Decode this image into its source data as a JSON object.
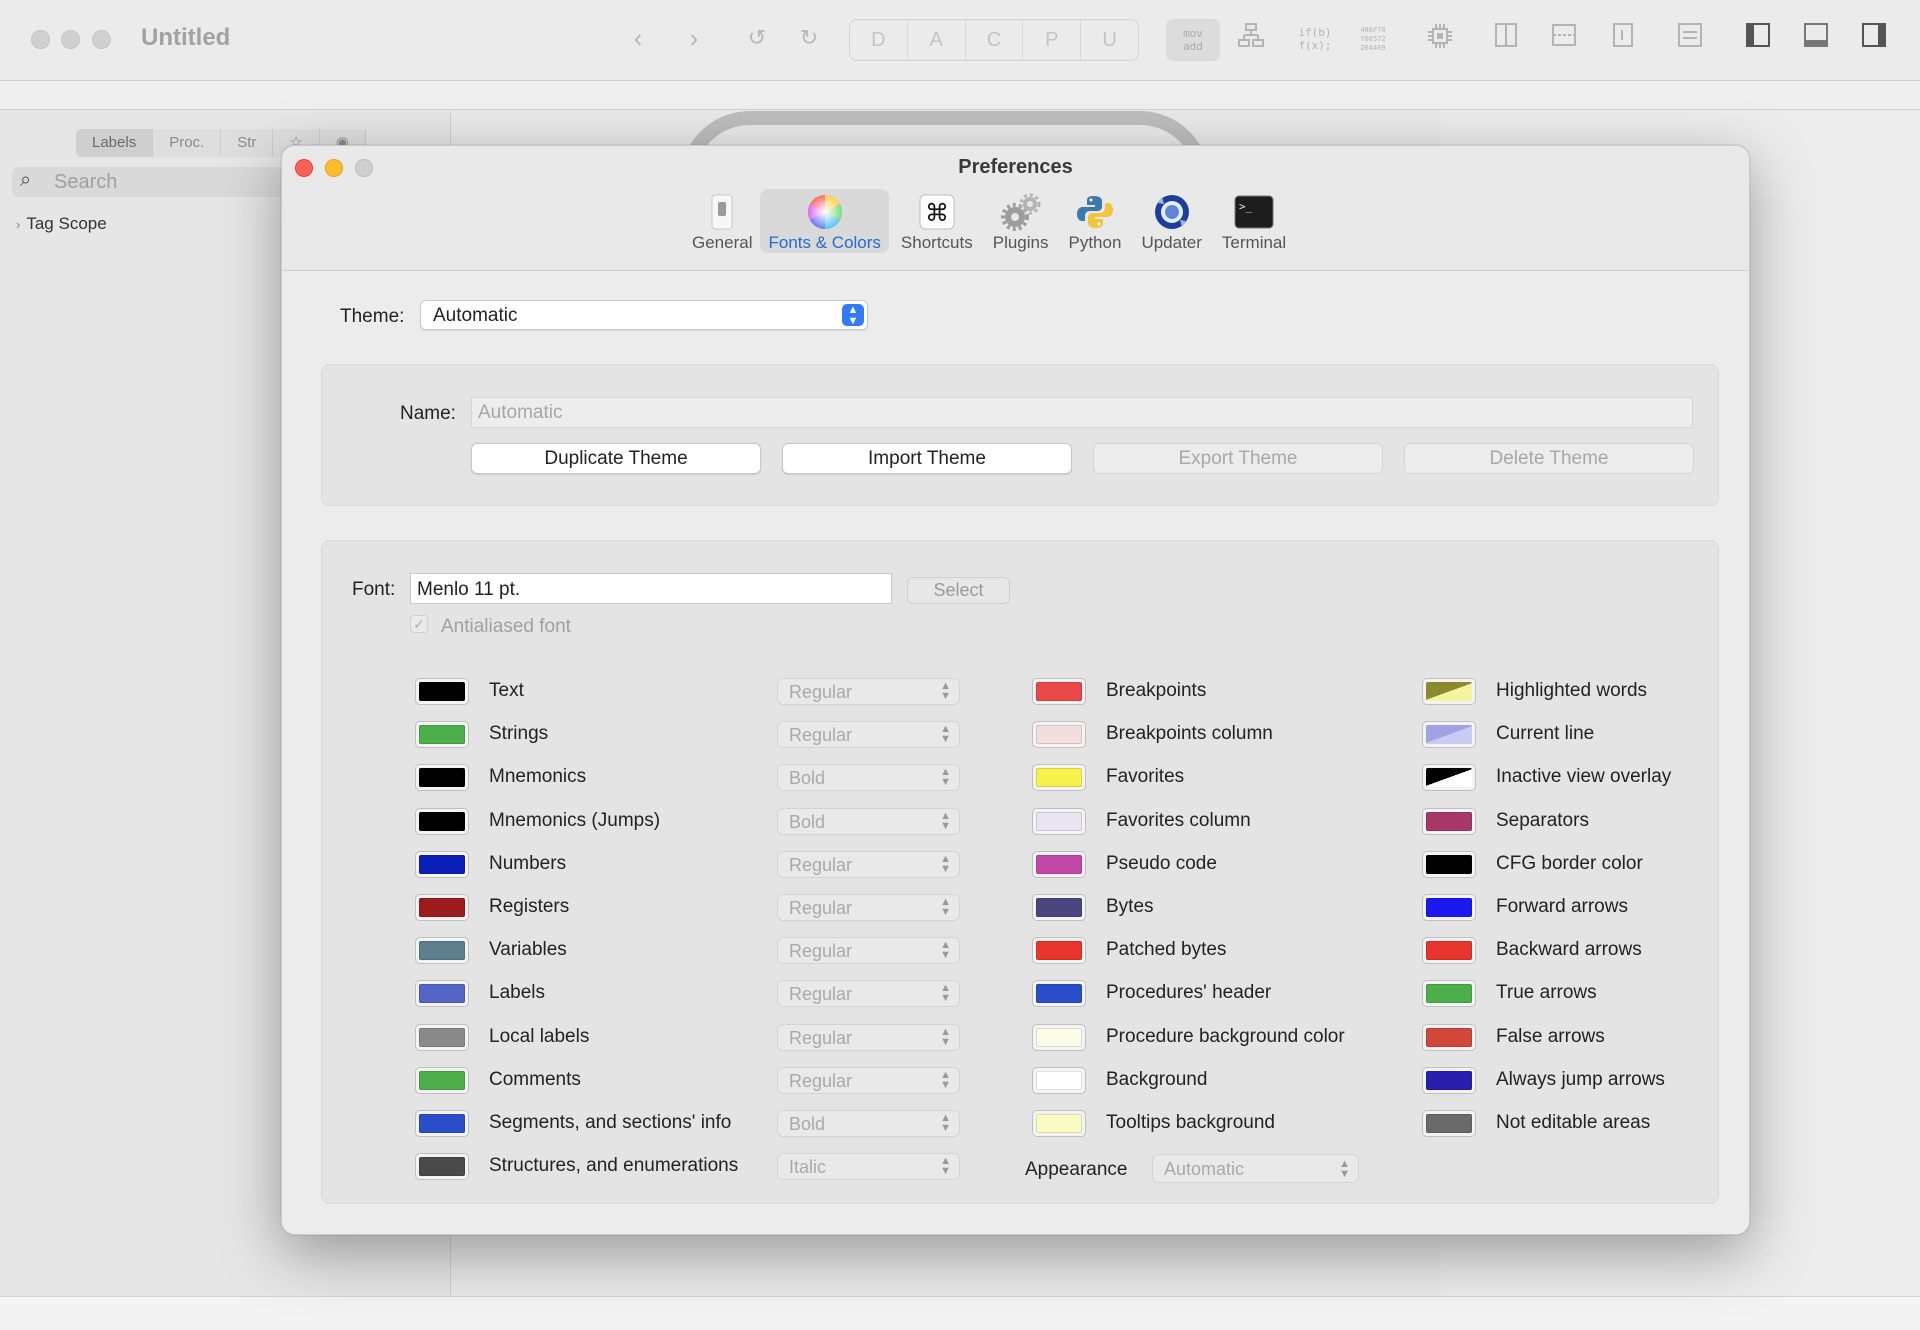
{
  "app": {
    "title": "Untitled",
    "toolbar_segments": [
      "D",
      "A",
      "C",
      "P",
      "U"
    ],
    "mov_add": "mov\nadd",
    "func_code": "if(b)\nf(x);",
    "hex_code": "486F70\n706572\n204469"
  },
  "sidebar": {
    "tabs": [
      "Labels",
      "Proc.",
      "Str",
      "☆",
      "◉"
    ],
    "search_placeholder": "Search",
    "tree_item": "Tag Scope"
  },
  "dialog": {
    "title": "Preferences",
    "tabs": [
      {
        "label": "General",
        "icon": "switch-icon"
      },
      {
        "label": "Fonts & Colors",
        "icon": "color-wheel-icon",
        "active": true
      },
      {
        "label": "Shortcuts",
        "icon": "command-key-icon"
      },
      {
        "label": "Plugins",
        "icon": "gears-icon"
      },
      {
        "label": "Python",
        "icon": "python-icon"
      },
      {
        "label": "Updater",
        "icon": "updater-icon"
      },
      {
        "label": "Terminal",
        "icon": "terminal-icon"
      }
    ],
    "theme": {
      "label": "Theme:",
      "value": "Automatic"
    },
    "name": {
      "label": "Name:",
      "placeholder": "Automatic"
    },
    "buttons": {
      "duplicate": "Duplicate Theme",
      "import": "Import Theme",
      "export": "Export Theme",
      "delete": "Delete Theme"
    },
    "font": {
      "label": "Font:",
      "value": "Menlo 11 pt.",
      "select": "Select",
      "antialiased": "Antialiased font"
    },
    "col1": [
      {
        "label": "Text",
        "color": "#000000",
        "style": "Regular"
      },
      {
        "label": "Strings",
        "color": "#4daf4a",
        "style": "Regular"
      },
      {
        "label": "Mnemonics",
        "color": "#000000",
        "style": "Bold"
      },
      {
        "label": "Mnemonics (Jumps)",
        "color": "#000000",
        "style": "Bold"
      },
      {
        "label": "Numbers",
        "color": "#0a1fb8",
        "style": "Regular"
      },
      {
        "label": "Registers",
        "color": "#9c1c1c",
        "style": "Regular"
      },
      {
        "label": "Variables",
        "color": "#5b7f8c",
        "style": "Regular"
      },
      {
        "label": "Labels",
        "color": "#5566c9",
        "style": "Regular"
      },
      {
        "label": "Local labels",
        "color": "#8a8a8a",
        "style": "Regular"
      },
      {
        "label": "Comments",
        "color": "#4daf4a",
        "style": "Regular"
      },
      {
        "label": "Segments, and sections' info",
        "color": "#2a4ec9",
        "style": "Bold"
      },
      {
        "label": "Structures, and enumerations",
        "color": "#4a4a4a",
        "style": "Italic"
      }
    ],
    "col2": [
      {
        "label": "Breakpoints",
        "color": "#e84848"
      },
      {
        "label": "Breakpoints column",
        "color": "#f3dede"
      },
      {
        "label": "Favorites",
        "color": "#f7f24a"
      },
      {
        "label": "Favorites column",
        "color": "#e8e4f2"
      },
      {
        "label": "Pseudo code",
        "color": "#c248a8"
      },
      {
        "label": "Bytes",
        "color": "#4a4680"
      },
      {
        "label": "Patched bytes",
        "color": "#e8342c"
      },
      {
        "label": "Procedures' header",
        "color": "#2a4ec9"
      },
      {
        "label": "Procedure background color",
        "color": "#fbfbe8"
      },
      {
        "label": "Background",
        "color": "#ffffff"
      },
      {
        "label": "Tooltips background",
        "color": "#fbfbc4"
      }
    ],
    "col3": [
      {
        "label": "Highlighted words",
        "color": "#8c8a2e",
        "color2": "#f5f3a0"
      },
      {
        "label": "Current line",
        "color": "#9fa3e3",
        "color2": "#c8cbf3"
      },
      {
        "label": "Inactive view overlay",
        "color": "#000000",
        "color2": "#ffffff"
      },
      {
        "label": "Separators",
        "color": "#a8386a"
      },
      {
        "label": "CFG border color",
        "color": "#000000"
      },
      {
        "label": "Forward arrows",
        "color": "#1a1af0"
      },
      {
        "label": "Backward arrows",
        "color": "#e8342c"
      },
      {
        "label": "True arrows",
        "color": "#4daf4a"
      },
      {
        "label": "False arrows",
        "color": "#d1473a"
      },
      {
        "label": "Always jump arrows",
        "color": "#2a1eb0"
      },
      {
        "label": "Not editable areas",
        "color": "#6a6a6a"
      }
    ],
    "appearance": {
      "label": "Appearance",
      "value": "Automatic"
    }
  }
}
